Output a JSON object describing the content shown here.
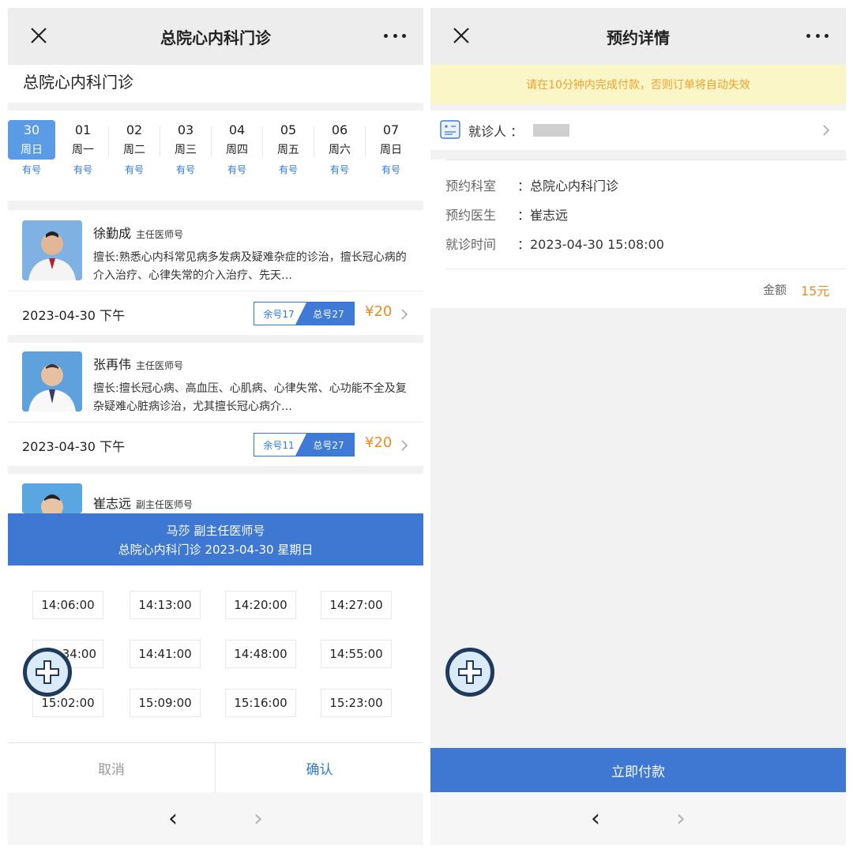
{
  "left": {
    "title": "总院心内科门诊",
    "dept_heading": "总院心内科门诊",
    "dates": [
      {
        "num": "30",
        "week": "周日",
        "avail": "有号",
        "selected": true
      },
      {
        "num": "01",
        "week": "周一",
        "avail": "有号"
      },
      {
        "num": "02",
        "week": "周二",
        "avail": "有号"
      },
      {
        "num": "03",
        "week": "周三",
        "avail": "有号"
      },
      {
        "num": "04",
        "week": "周四",
        "avail": "有号"
      },
      {
        "num": "05",
        "week": "周五",
        "avail": "有号"
      },
      {
        "num": "06",
        "week": "周六",
        "avail": "有号"
      },
      {
        "num": "07",
        "week": "周日",
        "avail": "有号"
      }
    ],
    "doctors": [
      {
        "name": "徐勤成",
        "rank": "主任医师号",
        "specialty": "擅长:熟悉心内科常见病多发病及疑难杂症的诊治，擅长冠心病的介入治疗、心律失常的介入治疗、先天…",
        "date": "2023-04-30 下午",
        "remaining": "余号17",
        "total": "总号27",
        "price": "¥20"
      },
      {
        "name": "张再伟",
        "rank": "主任医师号",
        "specialty": "擅长:擅长冠心病、高血压、心肌病、心律失常、心功能不全及复杂疑难心脏病诊治，尤其擅长冠心病介…",
        "date": "2023-04-30 下午",
        "remaining": "余号11",
        "total": "总号27",
        "price": "¥20"
      },
      {
        "name": "崔志远",
        "rank": "副主任医师号"
      }
    ],
    "popup": {
      "doctor_line": "马莎  副主任医师号",
      "dept_line": "总院心内科门诊  2023-04-30  星期日"
    },
    "slots": [
      "14:06:00",
      "14:13:00",
      "14:20:00",
      "14:27:00",
      "14:34:00",
      "14:41:00",
      "14:48:00",
      "14:55:00",
      "15:02:00",
      "15:09:00",
      "15:16:00",
      "15:23:00"
    ],
    "slot_partial": "34:00",
    "cancel_label": "取消",
    "confirm_label": "确认"
  },
  "right": {
    "title": "预约详情",
    "warning": "请在10分钟内完成付款，否则订单将自动失效",
    "patient_label": "就诊人 ：",
    "info": [
      {
        "label": "预约科室",
        "value": "：总院心内科门诊"
      },
      {
        "label": "预约医生",
        "value": "：崔志远"
      },
      {
        "label": "就诊时间",
        "value": "：2023-04-30 15:08:00"
      }
    ],
    "amount_label": "金额",
    "amount_value": "15元",
    "pay_label": "立即付款"
  },
  "nav": {
    "back": "‹",
    "forward": "›"
  },
  "colors": {
    "accent": "#3e78d3",
    "price": "#f08a24",
    "warning_bg": "#fbf6c7",
    "warning_text": "#f0a22e"
  },
  "icons": [
    "close-icon",
    "more-icon",
    "chevron-right-icon",
    "plus-fab-icon",
    "patient-card-icon",
    "back-icon",
    "forward-icon"
  ]
}
